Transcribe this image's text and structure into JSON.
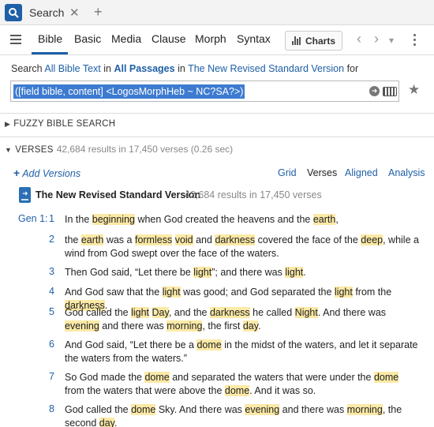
{
  "tab": {
    "label": "Search",
    "icon": "search-icon"
  },
  "toolbar": {
    "tabs": [
      "Bible",
      "Basic",
      "Media",
      "Clause",
      "Morph",
      "Syntax"
    ],
    "active_tab": "Bible",
    "charts_label": "Charts"
  },
  "search": {
    "prefix": "Search",
    "scope": "All Bible Text",
    "in1": "in",
    "passages": "All Passages",
    "in2": "in",
    "version": "The New Revised Standard Version",
    "for": "for",
    "query": "([field bible, content] <LogosMorphHeb ~ NC?SA?>)"
  },
  "sections": {
    "fuzzy": "FUZZY BIBLE SEARCH",
    "verses": "VERSES",
    "verses_meta": "42,684 results in 17,450 verses (0.26 sec)"
  },
  "results": {
    "add_versions": "Add Versions",
    "view_tabs": [
      "Grid",
      "Verses",
      "Aligned",
      "Analysis"
    ],
    "active_view": "Verses",
    "version_title": "The New Revised Standard Version",
    "version_meta": "42,684 results in 17,450 verses",
    "book_ref": "Gen 1:",
    "verses": [
      {
        "num": "1",
        "segments": [
          [
            "In the ",
            0
          ],
          [
            "beginning",
            1
          ],
          [
            " when God created the heavens and the ",
            0
          ],
          [
            "earth",
            1
          ],
          [
            ",",
            0
          ]
        ]
      },
      {
        "num": "2",
        "segments": [
          [
            "the ",
            0
          ],
          [
            "earth",
            1
          ],
          [
            " was a ",
            0
          ],
          [
            "formless",
            1
          ],
          [
            " ",
            0
          ],
          [
            "void",
            1
          ],
          [
            " and ",
            0
          ],
          [
            "darkness",
            1
          ],
          [
            " covered the face of the ",
            0
          ],
          [
            "deep",
            1
          ],
          [
            ", while a wind from God swept over the face of the waters.",
            0
          ]
        ]
      },
      {
        "num": "3",
        "segments": [
          [
            "Then God said, “Let there be ",
            0
          ],
          [
            "light",
            1
          ],
          [
            "”; and there was ",
            0
          ],
          [
            "light",
            1
          ],
          [
            ".",
            0
          ]
        ]
      },
      {
        "num": "4",
        "segments": [
          [
            "And God saw that the ",
            0
          ],
          [
            "light",
            1
          ],
          [
            " was good; and God separated the ",
            0
          ],
          [
            "light",
            1
          ],
          [
            " from the ",
            0
          ],
          [
            "darkness",
            1
          ],
          [
            ".",
            0
          ]
        ]
      },
      {
        "num": "5",
        "segments": [
          [
            "God called the ",
            0
          ],
          [
            "light",
            1
          ],
          [
            " ",
            0
          ],
          [
            "Day",
            1
          ],
          [
            ", and the ",
            0
          ],
          [
            "darkness",
            1
          ],
          [
            " he called ",
            0
          ],
          [
            "Night",
            1
          ],
          [
            ". And there was ",
            0
          ],
          [
            "evening",
            1
          ],
          [
            " and there was ",
            0
          ],
          [
            "morning",
            1
          ],
          [
            ", the first ",
            0
          ],
          [
            "day",
            1
          ],
          [
            ".",
            0
          ]
        ]
      },
      {
        "num": "6",
        "segments": [
          [
            "And God said, “Let there be a ",
            0
          ],
          [
            "dome",
            1
          ],
          [
            " in the midst of the waters, and let it separate the waters from the waters.”",
            0
          ]
        ]
      },
      {
        "num": "7",
        "segments": [
          [
            "So God made the ",
            0
          ],
          [
            "dome",
            1
          ],
          [
            " and separated the waters that were under the ",
            0
          ],
          [
            "dome",
            1
          ],
          [
            " from the waters that were above the ",
            0
          ],
          [
            "dome",
            1
          ],
          [
            ". And it was so.",
            0
          ]
        ]
      },
      {
        "num": "8",
        "segments": [
          [
            "God called the ",
            0
          ],
          [
            "dome",
            1
          ],
          [
            " Sky. And there was ",
            0
          ],
          [
            "evening",
            1
          ],
          [
            " and there was ",
            0
          ],
          [
            "morning",
            1
          ],
          [
            ", the second ",
            0
          ],
          [
            "day",
            1
          ],
          [
            ".",
            0
          ]
        ]
      }
    ]
  },
  "colors": {
    "accent": "#1f5fa6",
    "highlight": "#fbe9a6",
    "selection": "#3d7bd0"
  }
}
